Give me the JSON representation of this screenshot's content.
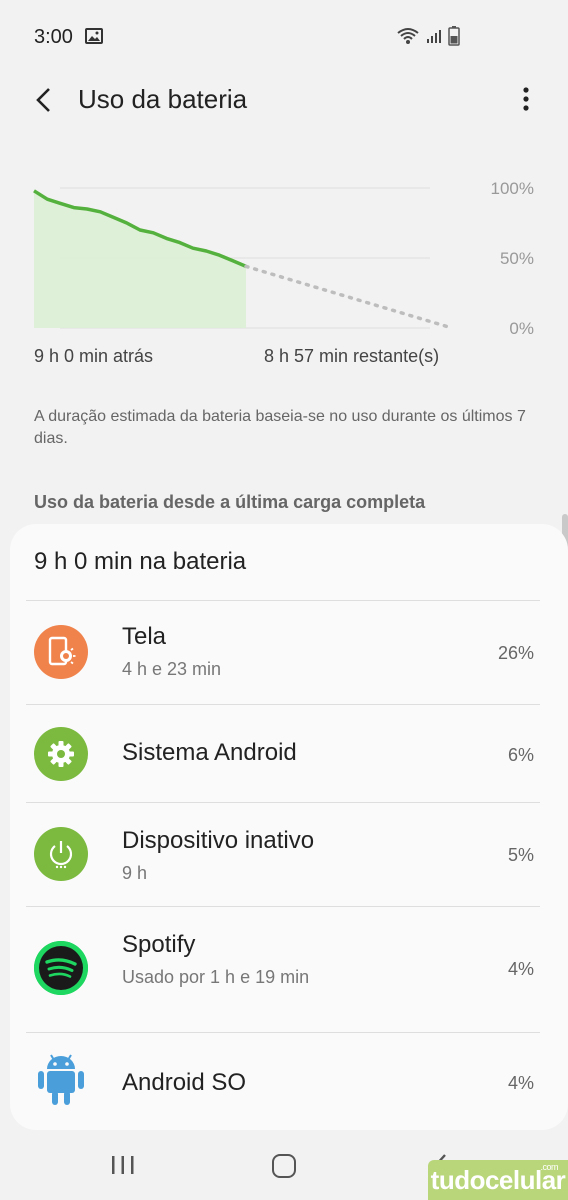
{
  "status_bar": {
    "time": "3:00",
    "icons": [
      "image-icon",
      "wifi-icon",
      "signal-icon",
      "battery-icon"
    ]
  },
  "app_bar": {
    "title": "Uso da bateria",
    "back_icon": "chevron-left-icon",
    "more_icon": "more-vertical-icon"
  },
  "chart_data": {
    "type": "line",
    "ylabel_ticks": [
      "100%",
      "50%",
      "0%"
    ],
    "ylim": [
      0,
      100
    ],
    "series": [
      {
        "values": [
          98,
          92,
          89,
          86,
          85,
          83,
          79,
          75,
          70,
          68,
          64,
          61,
          57,
          55,
          52,
          48,
          44
        ]
      },
      {
        "values": [
          44,
          0
        ],
        "style": "dotted"
      }
    ],
    "left_caption": "9 h 0 min atrás",
    "right_caption": "8 h 57 min restante(s)",
    "colors": {
      "line": "#55b13d",
      "fill": "#dcefd5",
      "projection": "#bdbdbd",
      "grid": "#dddddd"
    }
  },
  "note": "A duração estimada da bateria baseia-se no uso durante os últimos 7 dias.",
  "section_header": "Uso da bateria desde a última carga completa",
  "card": {
    "title": "9 h 0 min na bateria",
    "items": [
      {
        "name": "Tela",
        "detail": "4 h e 23 min",
        "percent": "26%",
        "icon": "screen-brightness-icon",
        "color": "#f0834c"
      },
      {
        "name": "Sistema Android",
        "detail": "",
        "percent": "6%",
        "icon": "gear-icon",
        "color": "#7bb93f"
      },
      {
        "name": "Dispositivo inativo",
        "detail": "9 h",
        "percent": "5%",
        "icon": "power-icon",
        "color": "#7bb93f"
      },
      {
        "name": "Spotify",
        "detail": "Usado por 1 h e 19 min",
        "percent": "4%",
        "icon": "spotify-icon",
        "color": "#1ed760"
      },
      {
        "name": "Android SO",
        "detail": "",
        "percent": "4%",
        "icon": "android-icon",
        "color": "#4a9fdb"
      }
    ]
  },
  "nav_bar": {
    "icons": [
      "recents-icon",
      "home-icon",
      "back-icon"
    ]
  },
  "watermark": {
    "text": "tudocelular",
    "suffix": ".com"
  }
}
